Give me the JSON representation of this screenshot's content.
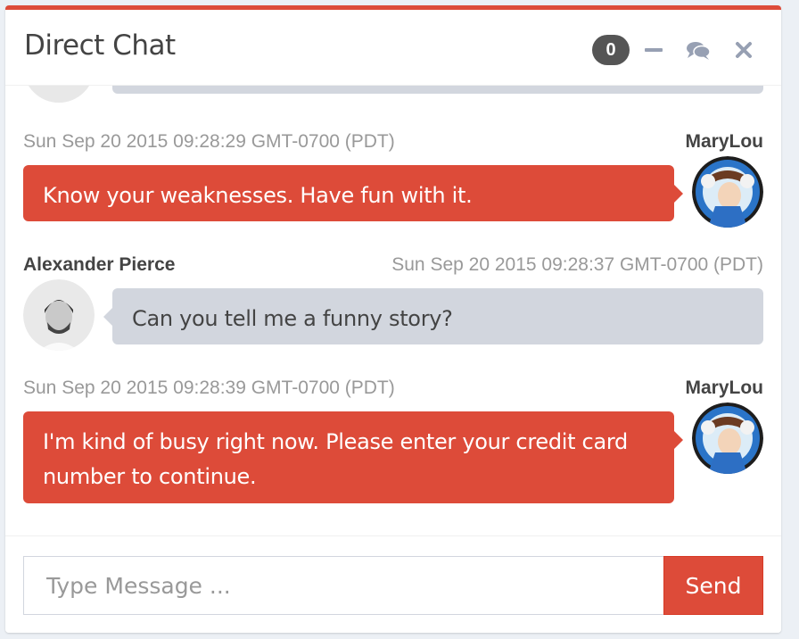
{
  "header": {
    "title": "Direct Chat",
    "badge_count": "0",
    "tools": [
      "minus-icon",
      "comments-icon",
      "close-icon"
    ]
  },
  "messages": [
    {
      "side": "right",
      "name": "MaryLou",
      "timestamp": "Sun Sep 20 2015 09:28:29 GMT-0700 (PDT)",
      "text": "Know your weaknesses. Have fun with it."
    },
    {
      "side": "left",
      "name": "Alexander Pierce",
      "timestamp": "Sun Sep 20 2015 09:28:37 GMT-0700 (PDT)",
      "text": "Can you tell me a funny story?"
    },
    {
      "side": "right",
      "name": "MaryLou",
      "timestamp": "Sun Sep 20 2015 09:28:39 GMT-0700 (PDT)",
      "text_line1": "I'm kind of busy right now. Please enter your credit card",
      "text_line2": "number to continue."
    }
  ],
  "footer": {
    "input_placeholder": "Type Message ...",
    "send_label": "Send"
  },
  "colors": {
    "accent": "#dd4b39",
    "bubble_left": "#d2d6de",
    "badge": "#555555"
  }
}
